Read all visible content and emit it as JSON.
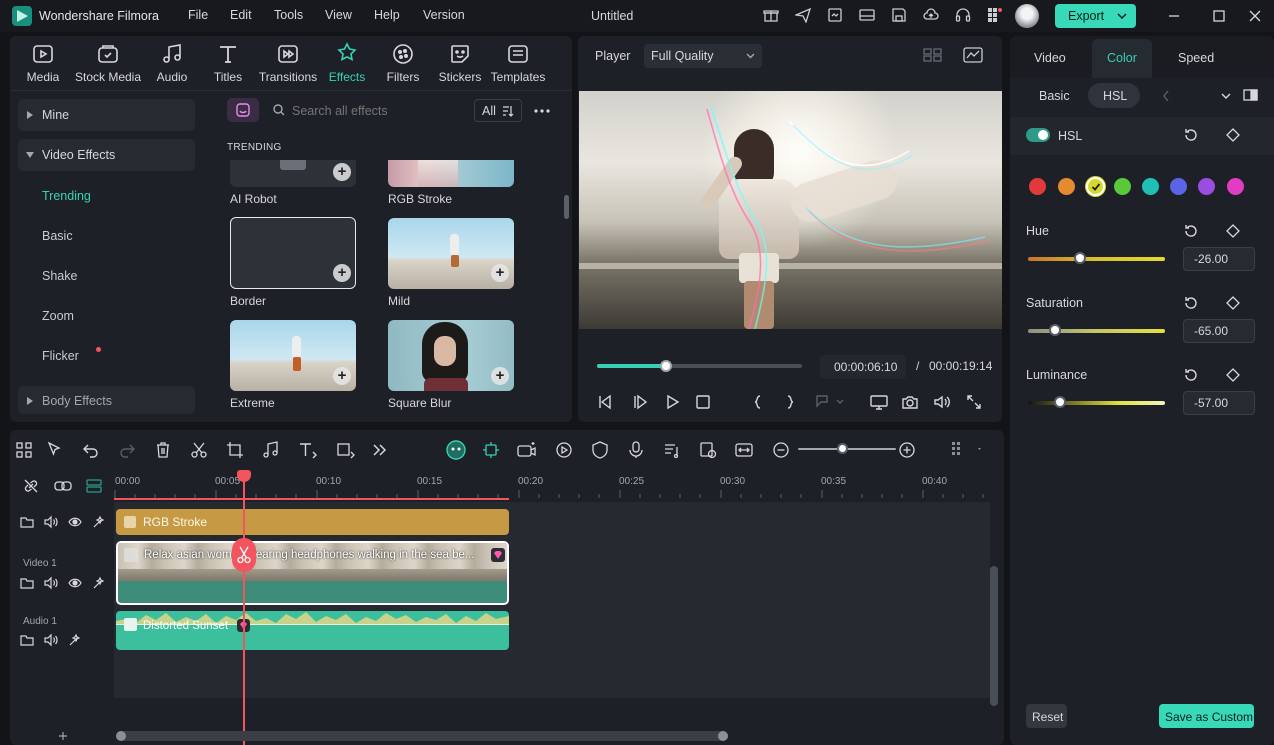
{
  "app": {
    "name": "Wondershare Filmora",
    "doc_title": "Untitled",
    "export_label": "Export"
  },
  "menu": [
    "File",
    "Edit",
    "Tools",
    "View",
    "Help",
    "Version"
  ],
  "toolbar_tabs": [
    {
      "label": "Media",
      "icon": "media-icon"
    },
    {
      "label": "Stock Media",
      "icon": "stock-media-icon"
    },
    {
      "label": "Audio",
      "icon": "audio-icon"
    },
    {
      "label": "Titles",
      "icon": "titles-icon"
    },
    {
      "label": "Transitions",
      "icon": "transitions-icon"
    },
    {
      "label": "Effects",
      "icon": "effects-icon",
      "active": true
    },
    {
      "label": "Filters",
      "icon": "filters-icon"
    },
    {
      "label": "Stickers",
      "icon": "stickers-icon"
    },
    {
      "label": "Templates",
      "icon": "templates-icon"
    }
  ],
  "effects_sidebar": {
    "mine": "Mine",
    "video_effects": "Video Effects",
    "subcategories": [
      "Trending",
      "Basic",
      "Shake",
      "Zoom",
      "Flicker"
    ],
    "body_effects": "Body Effects"
  },
  "effects_browser": {
    "search_placeholder": "Search all effects",
    "filter_label": "All",
    "section_title": "TRENDING",
    "items": [
      "AI Robot",
      "RGB Stroke",
      "Border",
      "Mild",
      "Extreme",
      "Square Blur"
    ]
  },
  "player": {
    "label": "Player",
    "quality": "Full Quality",
    "current_time": "00:00:06:10",
    "separator": "/",
    "total_time": "00:00:19:14",
    "progress": 0.34
  },
  "properties": {
    "tabs": [
      "Video",
      "Color",
      "Speed"
    ],
    "active_tab": "Color",
    "subtabs": [
      "Basic",
      "HSL"
    ],
    "active_subtab": "HSL",
    "section": "HSL",
    "swatches": [
      "#e23a3a",
      "#e58a2f",
      "#e3e23a",
      "#59c93a",
      "#1fbfb5",
      "#5a64e6",
      "#9b4de0",
      "#e03cc4"
    ],
    "selected_swatch": 2,
    "hue": {
      "label": "Hue",
      "value": "-26.00",
      "position": 0.38
    },
    "saturation": {
      "label": "Saturation",
      "value": "-65.00",
      "position": 0.2
    },
    "luminance": {
      "label": "Luminance",
      "value": "-57.00",
      "position": 0.23
    },
    "reset_label": "Reset",
    "save_label": "Save as Custom"
  },
  "timeline": {
    "ruler": [
      "00:00",
      "00:05",
      "00:10",
      "00:15",
      "00:20",
      "00:25",
      "00:30",
      "00:35",
      "00:40"
    ],
    "effect_clip": "RGB Stroke",
    "video_track": "Video 1",
    "video_clip": "Relax asian woman wearing headphones walking in the sea be...",
    "audio_track": "Audio 1",
    "audio_clip": "Distorted Sunset"
  },
  "colors": {
    "accent": "#38d0b5",
    "playhead": "#f2555e",
    "effect_clip": "#c69a45",
    "video_clip": "#3d8c7a",
    "audio_clip": "#3bbf9c"
  }
}
